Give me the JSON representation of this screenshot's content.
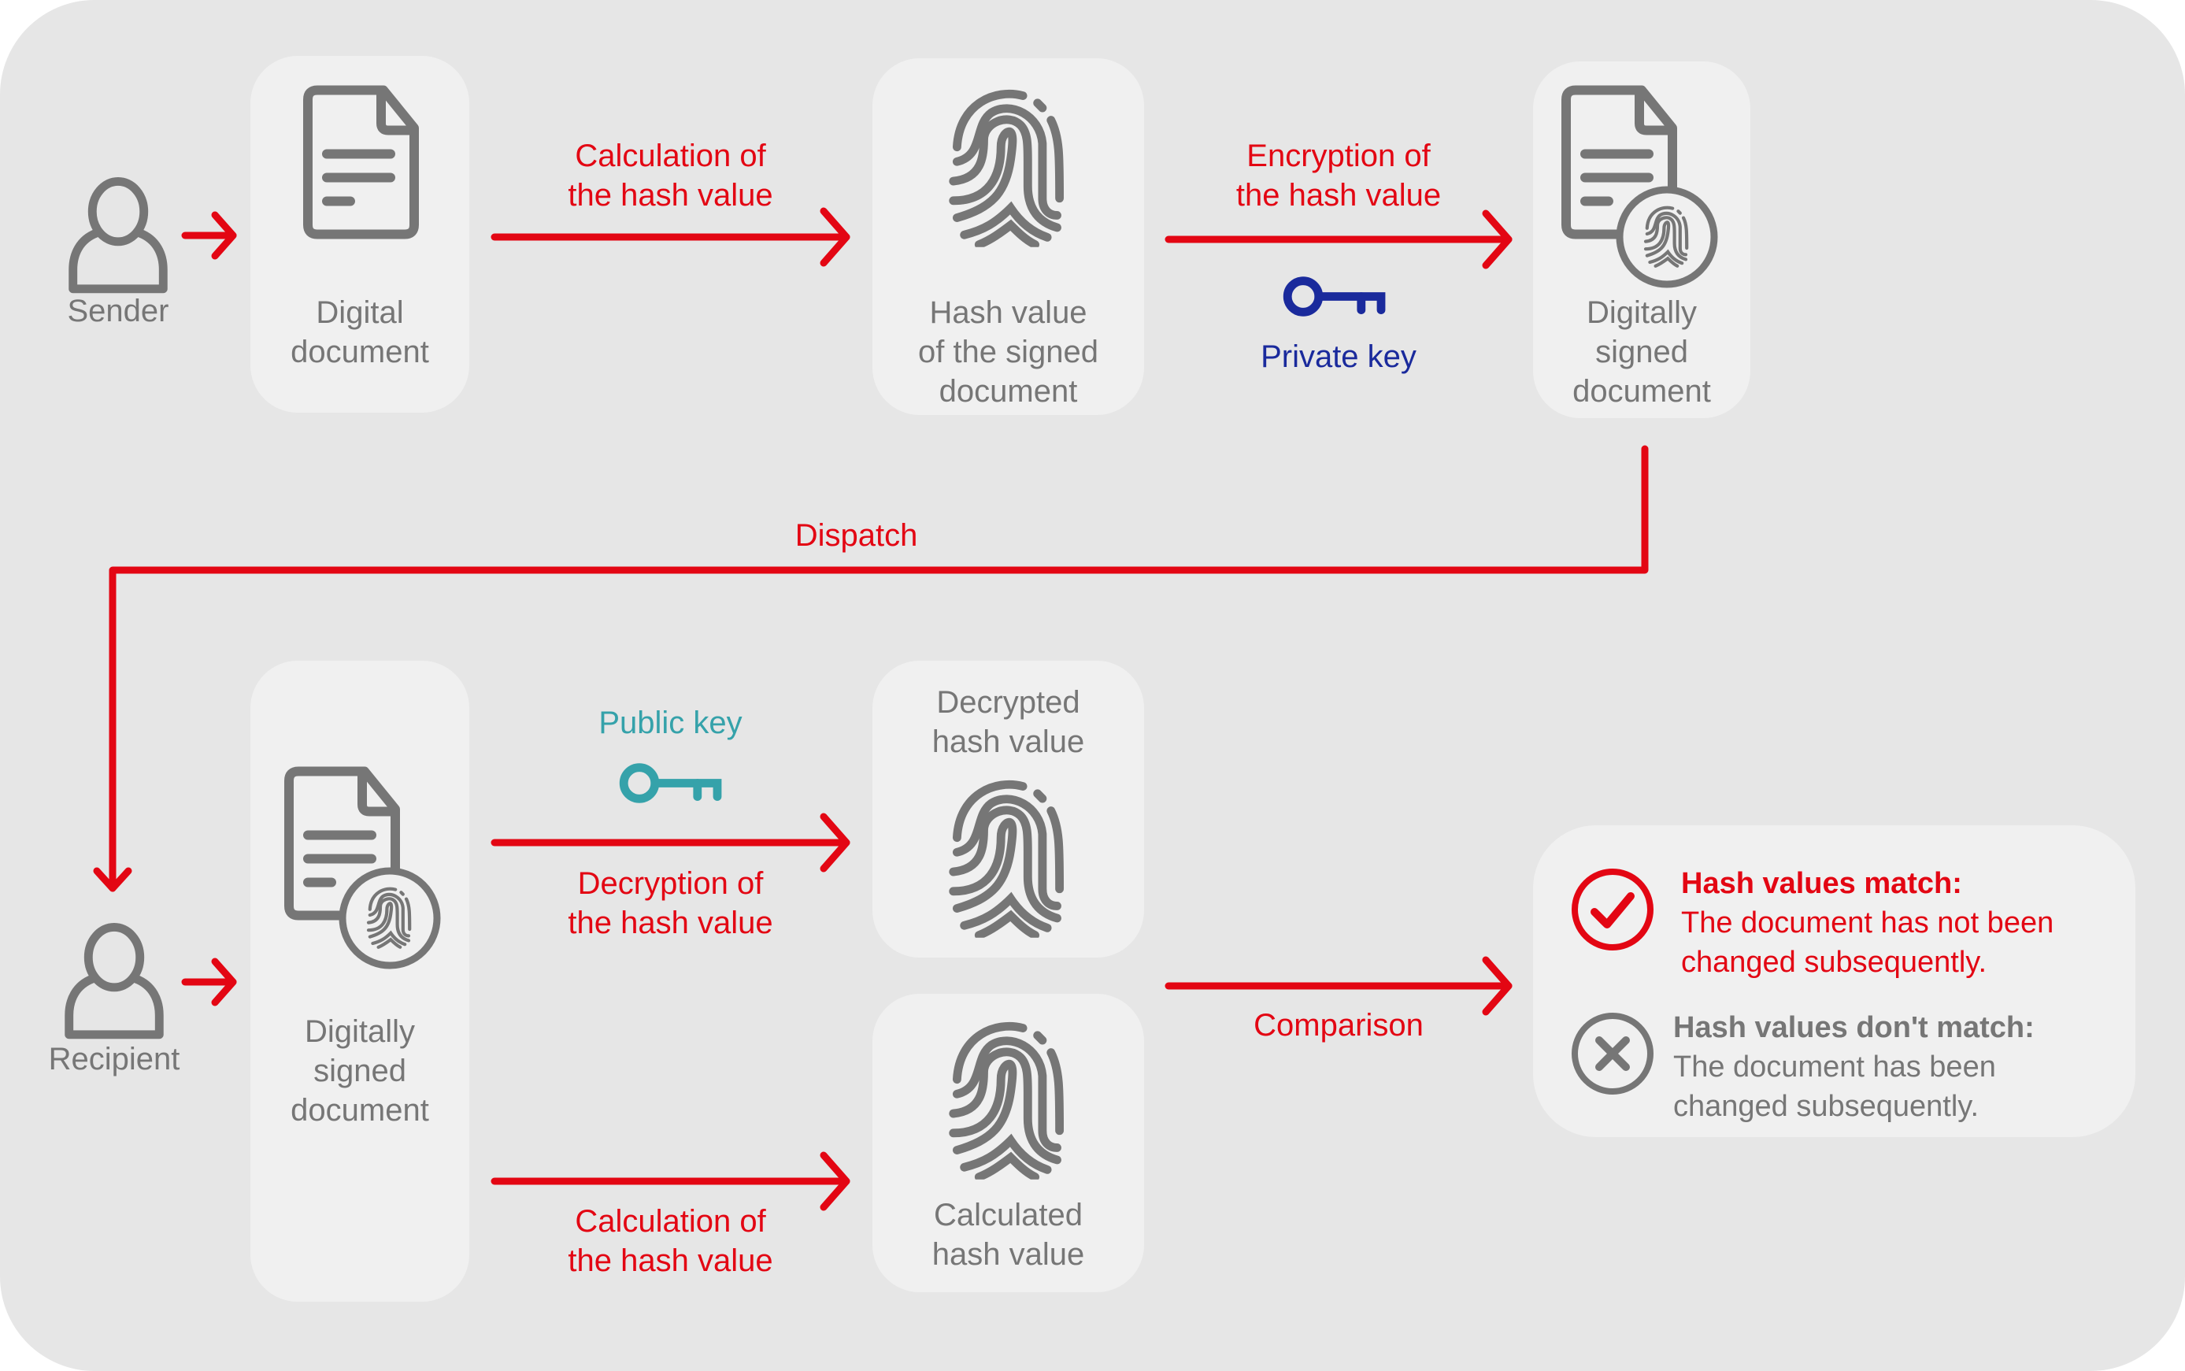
{
  "colors": {
    "background": "#e6e6e6",
    "card": "#f0f0f0",
    "arrow": "#e30613",
    "icon_gray": "#767676",
    "private_key": "#1a2a9c",
    "public_key": "#35a2aa"
  },
  "sender": {
    "actor_label": "Sender",
    "step1_box": "Digital document",
    "step1_line1": "Digital",
    "step1_line2": "document",
    "arrow1_line1": "Calculation of",
    "arrow1_line2": "the hash value",
    "step2_line1": "Hash value",
    "step2_line2": "of the signed",
    "step2_line3": "document",
    "arrow2_line1": "Encryption of",
    "arrow2_line2": "the hash value",
    "key_label": "Private key",
    "step3_line1": "Digitally",
    "step3_line2": "signed",
    "step3_line3": "document"
  },
  "dispatch": {
    "label": "Dispatch"
  },
  "recipient": {
    "actor_label": "Recipient",
    "doc_line1": "Digitally",
    "doc_line2": "signed",
    "doc_line3": "document",
    "key_label": "Public key",
    "arrow_decrypt_line1": "Decryption of",
    "arrow_decrypt_line2": "the hash value",
    "arrow_calc_line1": "Calculation of",
    "arrow_calc_line2": "the hash value",
    "decrypted_line1": "Decrypted",
    "decrypted_line2": "hash value",
    "calculated_line1": "Calculated",
    "calculated_line2": "hash value",
    "comparison_label": "Comparison"
  },
  "results": {
    "match_title": "Hash values match:",
    "match_text_line1": "The document has not been",
    "match_text_line2": "changed subsequently.",
    "mismatch_title": "Hash values don't match:",
    "mismatch_text_line1": "The document has been",
    "mismatch_text_line2": "changed subsequently."
  },
  "icons": {
    "sender": "user-icon",
    "recipient": "user-icon",
    "document": "document-icon",
    "hash": "fingerprint-icon",
    "signed_document": "signed-document-icon",
    "private_key": "key-icon",
    "public_key": "key-icon",
    "match": "check-circle-icon",
    "mismatch": "x-circle-icon"
  }
}
